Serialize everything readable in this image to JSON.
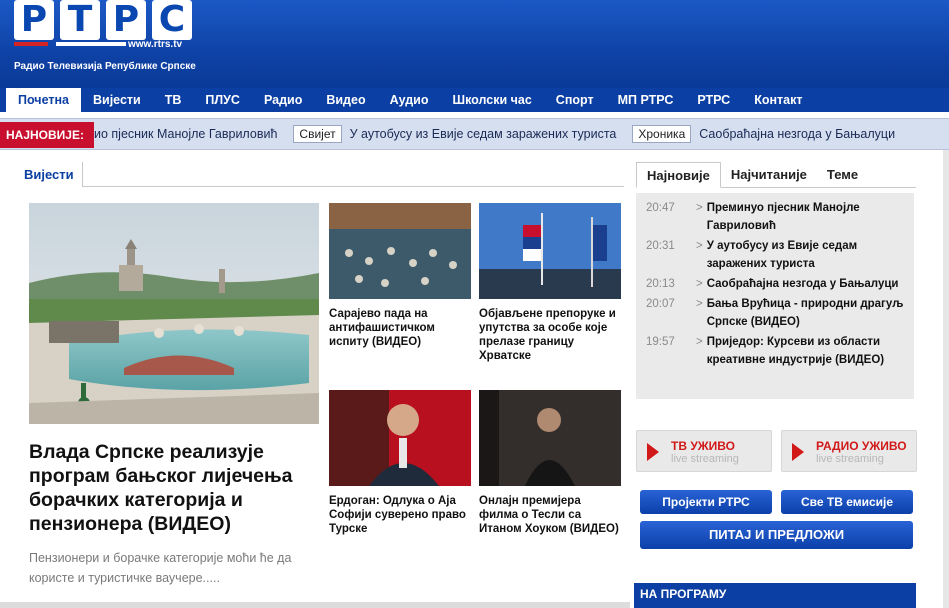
{
  "header": {
    "logo_letters": [
      "Р",
      "Т",
      "Р",
      "С"
    ],
    "logo_url": "www.rtrs.tv",
    "tagline": "Радио Телевизија Републике Српске"
  },
  "nav": {
    "items": [
      "Почетна",
      "Вијести",
      "ТВ",
      "ПЛУС",
      "Радио",
      "Видео",
      "Аудио",
      "Школски час",
      "Спорт",
      "МП РТРС",
      "РТРС",
      "Контакт"
    ],
    "active_index": 0
  },
  "ticker": {
    "label": "НАЈНОВИЈЕ:",
    "text1": "ио пјесник Манојле Гавриловић",
    "badge1": "Свијет",
    "text2": "У аутобусу из Евије седам заражених туриста",
    "badge2": "Хроника",
    "text3": "Саобраћајна незгода у Бањалуци"
  },
  "left_section": {
    "tab_label": "Вијести",
    "feature": {
      "title": "Влада Српске реализује програм бањског лијечења борачких категорија и пензионера (ВИДЕО)",
      "summary": "Пензионери и борачке категорије моћи ће да користе и туристичке ваучере....."
    },
    "grid": [
      {
        "caption": "Сарајево пада на антифашистичком испиту (ВИДЕО)"
      },
      {
        "caption": "Објављене препоруке и упутства за особе које прелазе границу Хрватске"
      },
      {
        "caption": "Ердоган: Одлука о Аја Софији суверено право Турске"
      },
      {
        "caption": "Онлајн премијера филма о Тесли са Итаном Хоуком (ВИДЕО)"
      }
    ]
  },
  "right_panel": {
    "tabs": [
      "Најновије",
      "Најчитаније",
      "Теме"
    ],
    "active_tab": 0,
    "latest": [
      {
        "time": "20:47",
        "text": "Преминуо пјесник Манојле Гавриловић"
      },
      {
        "time": "20:31",
        "text": "У аутобусу из Евије седам заражених туриста"
      },
      {
        "time": "20:13",
        "text": "Саобраћајна незгода у Бањалуци"
      },
      {
        "time": "20:07",
        "text": "Бања Врућица - природни драгуљ Српске (ВИДЕО)"
      },
      {
        "time": "19:57",
        "text": "Приједор: Курсеви из области креативне индустрије (ВИДЕО)"
      }
    ],
    "tv_live": {
      "title": "ТВ УЖИВО",
      "sub": "live streaming"
    },
    "radio_live": {
      "title": "РАДИО УЖИВО",
      "sub": "live streaming"
    },
    "btn_projects": "Пројекти РТРС",
    "btn_all_tv": "Све ТВ емисије",
    "btn_ask": "ПИТАЈ И ПРЕДЛОЖИ",
    "on_program": "НА ПРОГРАМУ"
  },
  "colors": {
    "brand_blue": "#0b3fa3",
    "accent_red": "#c8102e"
  }
}
